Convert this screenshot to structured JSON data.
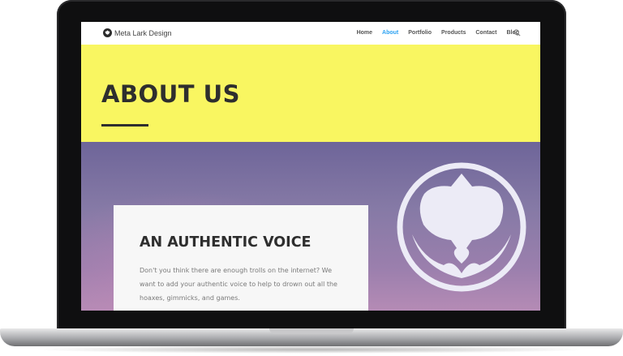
{
  "site": {
    "logo_text": "Meta Lark Design",
    "logo_icon": "lark-logo-icon"
  },
  "nav": {
    "items": [
      {
        "label": "Home",
        "active": false
      },
      {
        "label": "About",
        "active": true
      },
      {
        "label": "Portfolio",
        "active": false
      },
      {
        "label": "Products",
        "active": false
      },
      {
        "label": "Contact",
        "active": false
      },
      {
        "label": "Blog",
        "active": false
      }
    ],
    "search_icon": "search-icon",
    "active_color": "#2ea3f2"
  },
  "hero": {
    "title": "ABOUT US",
    "background": "#f9f661"
  },
  "section": {
    "card_title": "AN AUTHENTIC VOICE",
    "card_text": "Don't you think there are enough trolls on the internet? We want to add your authentic voice to help to drown out all the hoaxes, gimmicks, and games.",
    "emblem_icon": "lark-emblem-icon"
  }
}
